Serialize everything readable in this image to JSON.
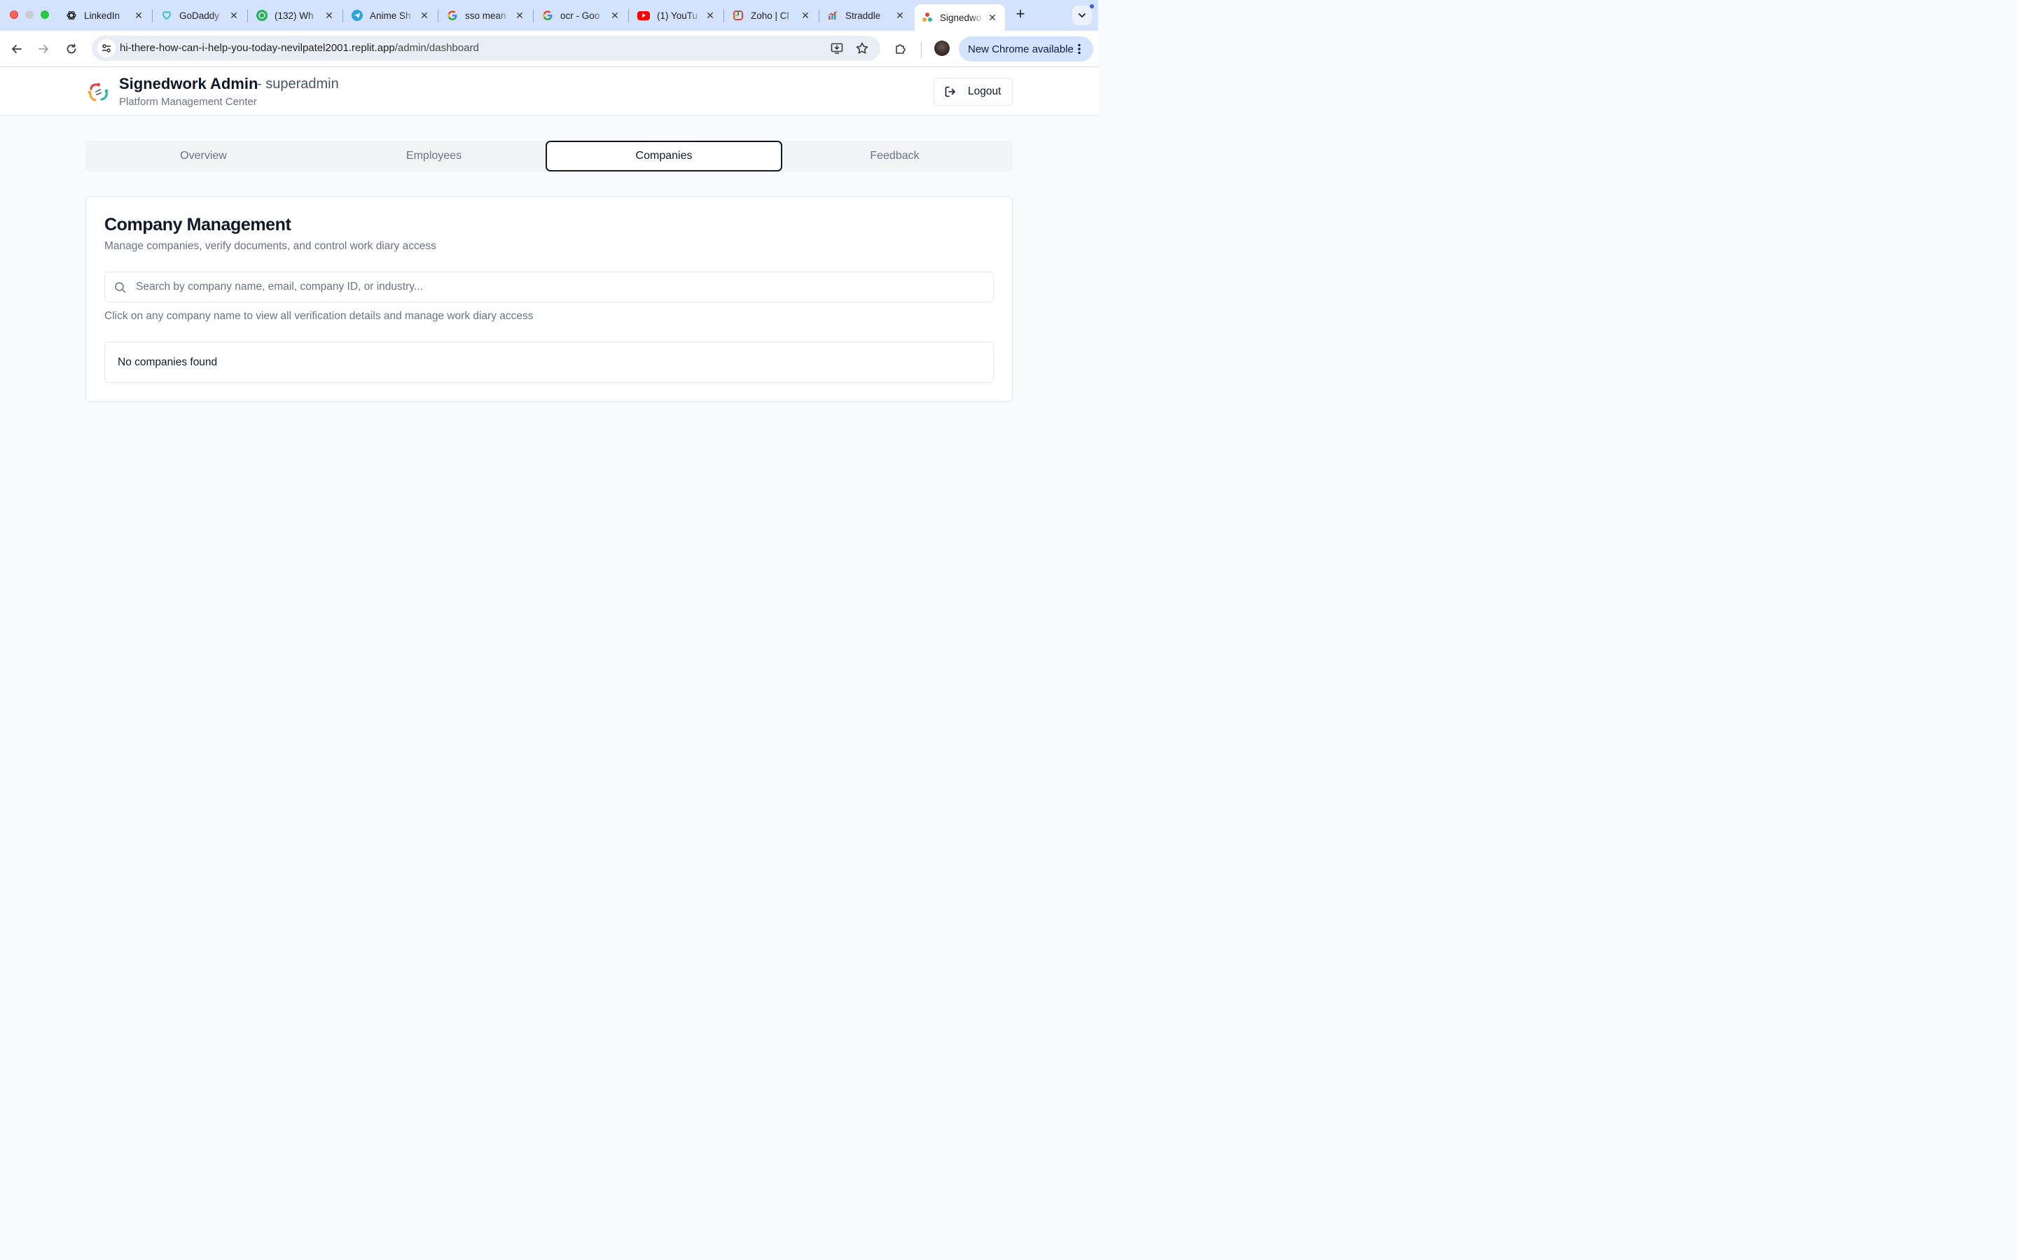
{
  "browser": {
    "tabs": [
      {
        "title": "LinkedIn",
        "icon": "openai-icon"
      },
      {
        "title": "GoDaddy",
        "icon": "godaddy-icon"
      },
      {
        "title": "(132) Wh",
        "icon": "whatsapp-icon"
      },
      {
        "title": "Anime Sh",
        "icon": "telegram-icon"
      },
      {
        "title": "sso mean",
        "icon": "google-icon"
      },
      {
        "title": "ocr - Goo",
        "icon": "google-icon"
      },
      {
        "title": "(1) YouTu",
        "icon": "youtube-icon"
      },
      {
        "title": "Zoho | Cl",
        "icon": "zoho-icon"
      },
      {
        "title": "Straddle",
        "icon": "chart-icon"
      },
      {
        "title": "Signedwo",
        "icon": "signedwork-icon",
        "active": true
      }
    ],
    "new_tab_label": "+",
    "url": {
      "host": "hi-there-how-can-i-help-you-today-nevilpatel2001.replit.app",
      "path": "/admin/dashboard"
    },
    "update_chip_label": "New Chrome available"
  },
  "header": {
    "title": "Signedwork Admin",
    "role": "- superadmin",
    "subtitle": "Platform Management Center",
    "logout_label": "Logout"
  },
  "nav": {
    "tabs": [
      {
        "label": "Overview",
        "active": false
      },
      {
        "label": "Employees",
        "active": false
      },
      {
        "label": "Companies",
        "active": true
      },
      {
        "label": "Feedback",
        "active": false
      }
    ]
  },
  "main": {
    "title": "Company Management",
    "description": "Manage companies, verify documents, and control work diary access",
    "search_placeholder": "Search by company name, email, company ID, or industry...",
    "search_value": "",
    "hint": "Click on any company name to view all verification details and manage work diary access",
    "empty_message": "No companies found"
  },
  "colors": {
    "tabstrip_bg": "#d3e3fd",
    "page_bg": "#f9fafb",
    "text_primary": "#111827",
    "text_muted": "#6b7280",
    "active_tab_border": "#111827"
  }
}
